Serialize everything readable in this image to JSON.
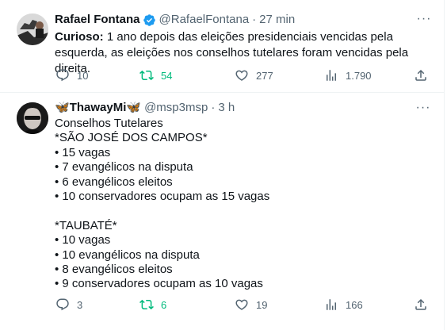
{
  "tweets": [
    {
      "author_name": "Rafael Fontana",
      "handle": "@RafaelFontana",
      "time": "27 min",
      "verified": true,
      "text_bold": "Curioso:",
      "text_rest": " 1 ano depois das eleições presidenciais vencidas pela esquerda, as eleições nos conselhos tutelares foram vencidas pela direita.",
      "replies": "10",
      "retweets": "54",
      "likes": "277",
      "views": "1.790"
    },
    {
      "author_name": "ThawayMi",
      "name_emoji": "🦋",
      "handle": "@msp3msp",
      "time": "3 h",
      "lines": [
        "Conselhos Tutelares",
        "*SÃO JOSÉ DOS CAMPOS*",
        "• 15 vagas",
        "• 7 evangélicos na disputa",
        "• 6 evangélicos eleitos",
        "• 10 conservadores ocupam as 15 vagas",
        "",
        "*TAUBATÉ*",
        "• 10 vagas",
        "• 10 evangélicos na disputa",
        "• 8 evangélicos eleitos",
        "• 9 conservadores ocupam as 10 vagas"
      ],
      "replies": "3",
      "retweets": "6",
      "likes": "19",
      "views": "166"
    }
  ],
  "colors": {
    "text": "#0f1419",
    "muted": "#536471",
    "retweet_active": "#00ba7c",
    "verified": "#1d9bf0",
    "divider": "#eff3f4"
  },
  "icons": [
    "verified-badge-icon",
    "more-icon",
    "reply-icon",
    "retweet-icon",
    "like-icon",
    "views-icon",
    "share-icon",
    "butterfly-emoji"
  ]
}
